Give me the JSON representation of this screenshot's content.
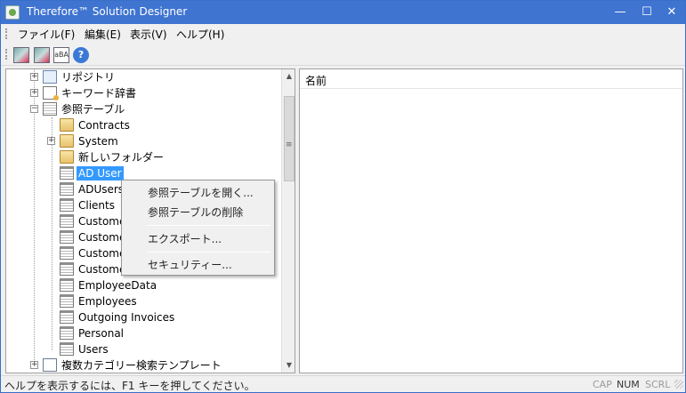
{
  "window": {
    "title": "Therefore™ Solution Designer",
    "minimize_glyph": "—",
    "maximize_glyph": "☐",
    "close_glyph": "✕"
  },
  "menubar": {
    "items": [
      {
        "label": "ファイル(F)"
      },
      {
        "label": "編集(E)"
      },
      {
        "label": "表示(V)"
      },
      {
        "label": "ヘルプ(H)"
      }
    ]
  },
  "toolbar": {
    "icons": [
      "design-tool-icon",
      "design-tool-2-icon",
      "abc-text-icon",
      "help-icon"
    ],
    "abc_glyph": "aBA",
    "help_glyph": "?"
  },
  "tree": {
    "items": [
      {
        "label": "リポジトリ",
        "icon": "repository-icon",
        "expander": "+"
      },
      {
        "label": "キーワード辞書",
        "icon": "keyword-dictionary-icon",
        "expander": "+"
      },
      {
        "label": "参照テーブル",
        "icon": "reference-table-icon",
        "expander": "−"
      },
      {
        "label": "Contracts",
        "icon": "folder-icon"
      },
      {
        "label": "System",
        "icon": "folder-icon",
        "expander": "+"
      },
      {
        "label": "新しいフォルダー",
        "icon": "folder-icon"
      },
      {
        "label": "AD User",
        "icon": "table-icon",
        "selected": true
      },
      {
        "label": "ADUsers",
        "icon": "table-icon"
      },
      {
        "label": "Clients",
        "icon": "table-icon"
      },
      {
        "label": "Custome",
        "icon": "table-icon"
      },
      {
        "label": "Custome",
        "icon": "table-icon"
      },
      {
        "label": "Custome",
        "icon": "table-icon"
      },
      {
        "label": "Custome",
        "icon": "table-icon"
      },
      {
        "label": "EmployeeData",
        "icon": "table-icon"
      },
      {
        "label": "Employees",
        "icon": "table-icon"
      },
      {
        "label": "Outgoing Invoices",
        "icon": "table-icon"
      },
      {
        "label": "Personal",
        "icon": "table-icon"
      },
      {
        "label": "Users",
        "icon": "table-icon"
      },
      {
        "label": "複数カテゴリー検索テンプレート",
        "icon": "multi-category-template-icon",
        "expander": "+"
      }
    ],
    "scroll_up_glyph": "▲",
    "scroll_down_glyph": "▼",
    "scroll_grip_glyph": "≡"
  },
  "context_menu": {
    "items": [
      {
        "label": "参照テーブルを開く..."
      },
      {
        "label": "参照テーブルの削除"
      },
      {
        "label": "エクスポート..."
      },
      {
        "label": "セキュリティー..."
      }
    ]
  },
  "list": {
    "column_header": "名前"
  },
  "statusbar": {
    "text": "ヘルプを表示するには、F1 キーを押してください。",
    "cap": "CAP",
    "num": "NUM",
    "scrl": "SCRL"
  },
  "colors": {
    "titlebar": "#3f74d0",
    "selection": "#3399ff",
    "chrome": "#f0f0f0"
  }
}
